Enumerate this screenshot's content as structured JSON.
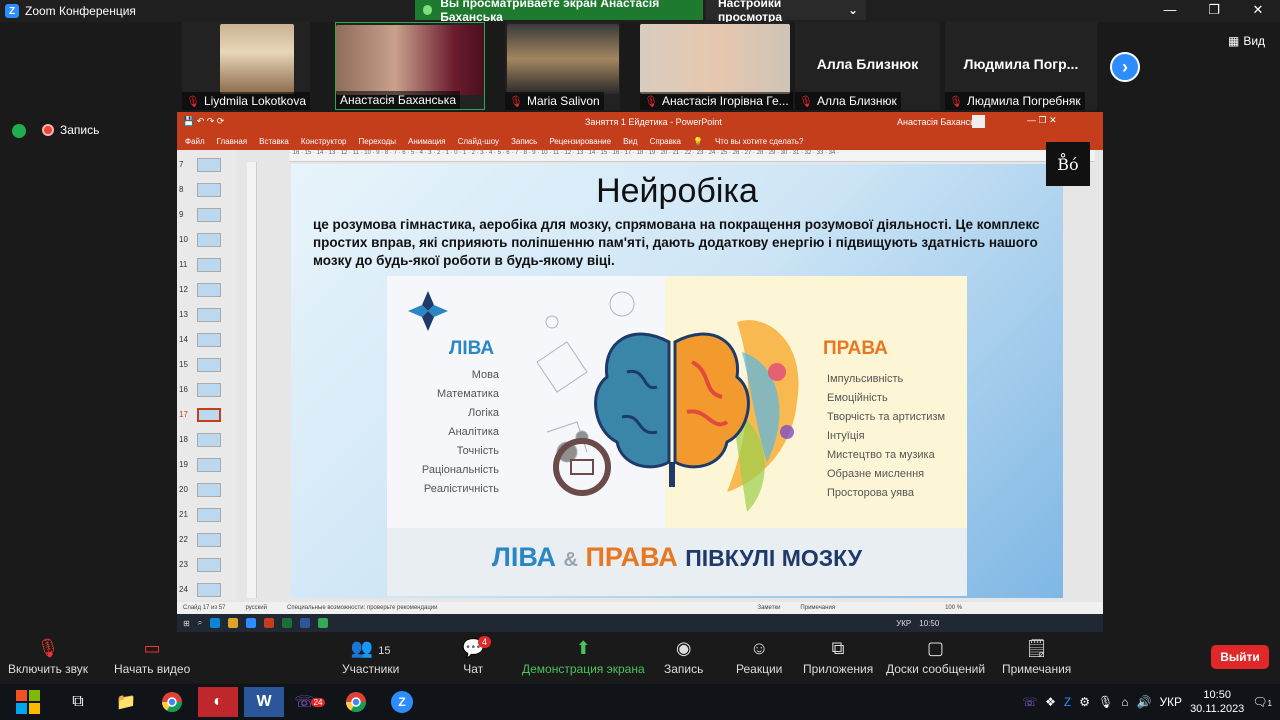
{
  "app": {
    "title": "Zoom Конференция"
  },
  "share_banner": {
    "text": "Вы просматриваете экран Анастасія Баханська",
    "view_settings": "Настройки просмотра"
  },
  "participants": [
    {
      "name": "Liydmila Lokotkova",
      "muted": true
    },
    {
      "name": "Анастасія Баханська",
      "muted": false
    },
    {
      "name": "Maria Salivon",
      "muted": true
    },
    {
      "name": "Анастасія Ігорівна Ге...",
      "muted": true
    },
    {
      "name": "Алла Близнюк",
      "big_name": "Алла Близнюк",
      "muted": true
    },
    {
      "name": "Людмила Погребняк",
      "big_name": "Людмила  Погр...",
      "muted": true
    }
  ],
  "view_button": "Вид",
  "record_label": "Запись",
  "ppt": {
    "title": "Заняття 1 Ейдетика  -  PowerPoint",
    "user": "Анастасія Баханська",
    "menu": [
      "Файл",
      "Главная",
      "Вставка",
      "Конструктор",
      "Переходы",
      "Анимация",
      "Слайд-шоу",
      "Запись",
      "Рецензирование",
      "Вид",
      "Справка",
      "Что вы хотите сделать?"
    ],
    "slide_numbers": [
      "7",
      "8",
      "9",
      "10",
      "11",
      "12",
      "13",
      "14",
      "15",
      "16",
      "17",
      "18",
      "19",
      "20",
      "21",
      "22",
      "23",
      "24"
    ],
    "active_slide": "17",
    "status_left": "Слайд 17 из 57",
    "status_lang": "русский",
    "status_access": "Специальные возможности: проверьте рекомендации",
    "status_notes": "Заметки",
    "status_comments": "Примечания",
    "zoom": "100 %",
    "taskbar_lang": "УКР",
    "taskbar_time": "10:50"
  },
  "slide": {
    "title": "Нейробіка",
    "text": "це розумова гімнастика, аеробіка для мозку, спрямована на покращення розумової діяльності. Це комплекс простих вправ, які сприяють поліпшенню пам'яті, дають додаткову енергію і підвищують здатність нашого мозку до будь-якої роботи в будь-якому віці.",
    "left_heading": "ЛІВА",
    "right_heading": "ПРАВА",
    "left_list": [
      "Мова",
      "Математика",
      "Логіка",
      "Аналітика",
      "Точність",
      "Раціональність",
      "Реалістичність"
    ],
    "right_list": [
      "Імпульсивність",
      "Емоційність",
      "Творчість та артистизм",
      "Інтуїція",
      "Мистецтво та музика",
      "Образне мислення",
      "Просторова уява"
    ],
    "bottom_left": "ЛІВА",
    "bottom_amp": "&",
    "bottom_right": "ПРАВА",
    "bottom_rest": "ПІВКУЛІ МОЗКУ"
  },
  "controls": {
    "audio": "Включить звук",
    "video": "Начать видео",
    "participants": "Участники",
    "participants_count": "15",
    "chat": "Чат",
    "chat_badge": "4",
    "share": "Демонстрация экрана",
    "record": "Запись",
    "reactions": "Реакции",
    "apps": "Приложения",
    "whiteboards": "Доски сообщений",
    "notes": "Примечания",
    "leave": "Выйти"
  },
  "windows": {
    "lang": "УКР",
    "time": "10:50",
    "date": "30.11.2023",
    "viber_badge": "24",
    "notif_badge": "1"
  },
  "colors": {
    "zoom_blue": "#2d8cff",
    "ppt_red": "#c43e1c",
    "left_blue": "#2a87c4",
    "right_orange": "#e87722",
    "navy": "#1d3a6b"
  }
}
